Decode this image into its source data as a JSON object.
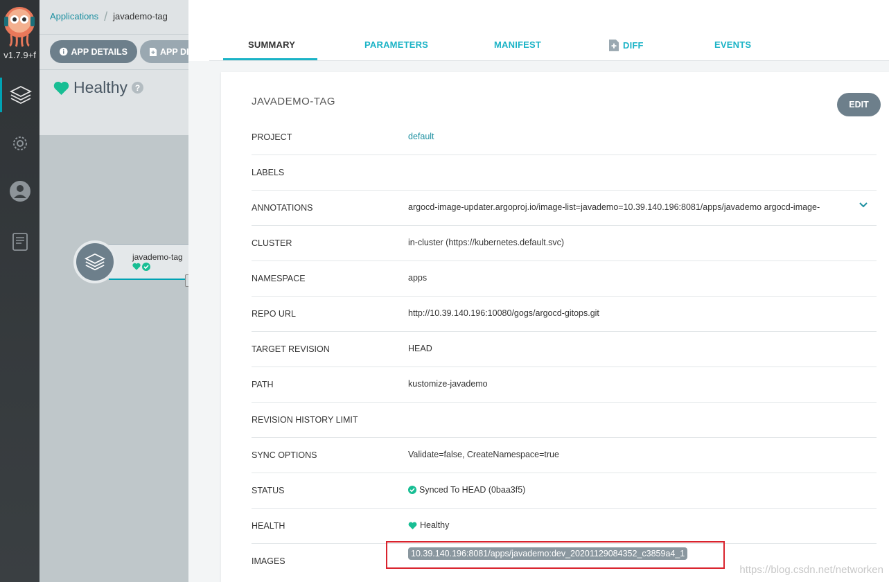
{
  "nav": {
    "version": "v1.7.9+f",
    "items": [
      {
        "icon": "layers-icon",
        "active": true
      },
      {
        "icon": "gear-icon",
        "active": false
      },
      {
        "icon": "user-icon",
        "active": false
      },
      {
        "icon": "docs-icon",
        "active": false
      }
    ]
  },
  "breadcrumb": {
    "parent": "Applications",
    "current": "javademo-tag"
  },
  "toolbar": {
    "details_label": "APP DETAILS",
    "diff_label": "APP DIFF"
  },
  "health": {
    "label": "Healthy"
  },
  "node": {
    "name": "javademo-tag"
  },
  "tabs": [
    "SUMMARY",
    "PARAMETERS",
    "MANIFEST",
    "DIFF",
    "EVENTS"
  ],
  "card": {
    "title": "JAVADEMO-TAG",
    "edit_label": "EDIT",
    "rows": [
      {
        "key": "PROJECT",
        "value": "default"
      },
      {
        "key": "LABELS",
        "value": ""
      },
      {
        "key": "ANNOTATIONS",
        "value": "argocd-image-updater.argoproj.io/image-list=javademo=10.39.140.196:8081/apps/javademo argocd-image-"
      },
      {
        "key": "CLUSTER",
        "value": "in-cluster (https://kubernetes.default.svc)"
      },
      {
        "key": "NAMESPACE",
        "value": "apps"
      },
      {
        "key": "REPO URL",
        "value": "http://10.39.140.196:10080/gogs/argocd-gitops.git"
      },
      {
        "key": "TARGET REVISION",
        "value": "HEAD"
      },
      {
        "key": "PATH",
        "value": "kustomize-javademo"
      },
      {
        "key": "REVISION HISTORY LIMIT",
        "value": ""
      },
      {
        "key": "SYNC OPTIONS",
        "value": "Validate=false, CreateNamespace=true"
      },
      {
        "key": "STATUS",
        "value": "Synced To HEAD (0baa3f5)"
      },
      {
        "key": "HEALTH",
        "value": "Healthy"
      },
      {
        "key": "IMAGES",
        "value": "10.39.140.196:8081/apps/javademo:dev_20201129084352_c3859a4_1"
      }
    ]
  },
  "watermark": "https://blog.csdn.net/networken",
  "colors": {
    "accent": "#1bb3c6",
    "healthy": "#18be94",
    "highlight": "#d9232d"
  }
}
